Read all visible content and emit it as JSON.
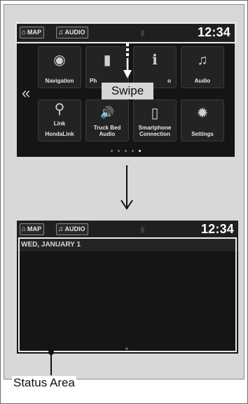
{
  "top_screen": {
    "status_bar": {
      "home_icon": "home-icon",
      "map_label": "MAP",
      "audio_icon": "music-note-icon",
      "audio_label": "AUDIO",
      "clock": "12:34"
    },
    "tiles": [
      {
        "label": "Navigation",
        "icon": "compass-icon",
        "glyph": "◉"
      },
      {
        "label": "Ph",
        "icon": "phone-icon",
        "glyph": "▮"
      },
      {
        "label": "o",
        "icon": "info-icon",
        "glyph": "ℹ"
      },
      {
        "label": "Audio",
        "icon": "music-note-icon",
        "glyph": "♫"
      },
      {
        "label": "Link",
        "icon": "hondalink-icon",
        "glyph": "⚲",
        "sublabel": "HondaLink"
      },
      {
        "label": "Truck Bed Audio",
        "icon": "truck-bed-audio-icon",
        "glyph": "🔊"
      },
      {
        "label": "Smartphone Connection",
        "icon": "smartphone-icon",
        "glyph": "▯"
      },
      {
        "label": "Settings",
        "icon": "gear-icon",
        "glyph": "✹"
      }
    ],
    "prev_page_icon": "double-chevron-left-icon",
    "prev_glyph": "«",
    "page_dots": 5,
    "active_page": 4,
    "swipe_label": "Swipe"
  },
  "bottom_screen": {
    "status_bar": {
      "map_label": "MAP",
      "audio_label": "AUDIO",
      "clock": "12:34"
    },
    "date": "WED, JANUARY 1"
  },
  "callout": {
    "label": "Status Area"
  },
  "colors": {
    "panel": "#d8d8d8",
    "screen": "#151515",
    "highlight": "#ececec"
  }
}
